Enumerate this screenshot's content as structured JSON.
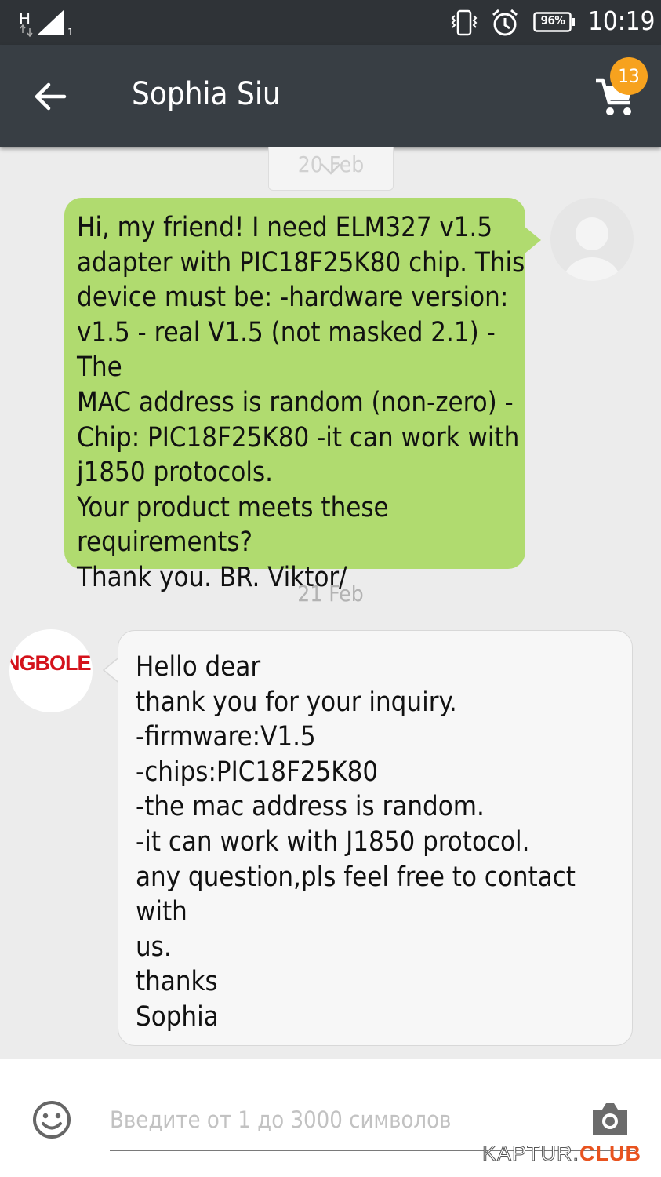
{
  "status_bar": {
    "network_type": "H",
    "signal_sub": "1",
    "battery_percent": "96%",
    "time": "10:19"
  },
  "header": {
    "title": "Sophia Siu",
    "cart_badge": "13"
  },
  "chat": {
    "faded_date": "20 Feb",
    "outgoing_message": "Hi, my friend! I need ELM327 v1.5\nadapter with PIC18F25K80 chip. This\ndevice must be: -hardware version:\nv1.5 - real V1.5 (not masked 2.1) -The\nMAC address is random (non-zero) -\nChip: PIC18F25K80 -it can work with\nj1850 protocols.\nYour product meets these\nrequirements?\nThank you. BR. Viktor/",
    "date_separator": "21 Feb",
    "seller_logo_text": "NGBOLE",
    "incoming_message": "Hello dear\nthank you for your inquiry.\n-firmware:V1.5\n-chips:PIC18F25K80\n-the mac address is random.\n-it can work with J1850 protocol.\nany question,pls feel free to contact with\nus.\nthanks\nSophia"
  },
  "composer": {
    "placeholder": "Введите от 1 до 3000 символов",
    "value": ""
  },
  "watermark": {
    "part1": "KAPTUR.",
    "part2": "CLUB"
  },
  "colors": {
    "status_bar_bg": "#2f3337",
    "app_bar_bg": "#383e44",
    "outgoing_bubble": "#b0db6f",
    "incoming_bubble": "#f7f7f7",
    "chat_bg": "#ececec",
    "badge": "#f7a21e",
    "seller_logo": "#d4121b"
  },
  "icons": [
    "signal-icon",
    "vibrate-icon",
    "alarm-icon",
    "battery-icon",
    "back-arrow-icon",
    "cart-icon",
    "chevron-down-icon",
    "user-avatar-icon",
    "emoji-icon",
    "camera-icon"
  ]
}
